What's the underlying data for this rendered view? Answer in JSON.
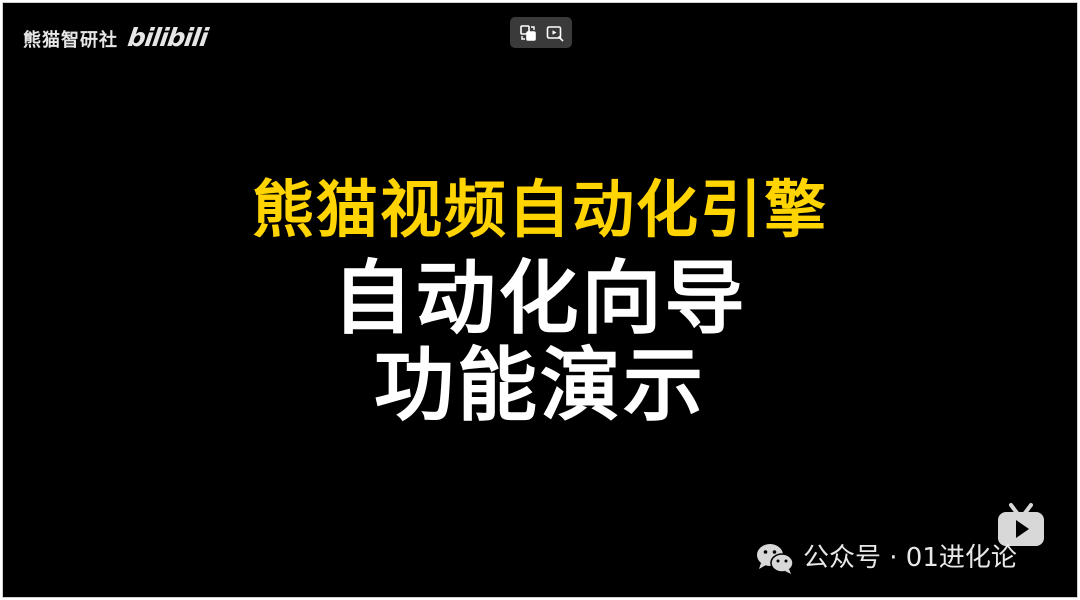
{
  "video": {
    "watermark_text": "熊猫智研社",
    "watermark_logo": "bilibili",
    "title_line1": "熊猫视频自动化引擎",
    "title_line2": "自动化向导",
    "title_line3": "功能演示",
    "title_line1_color": "#ffd400",
    "title_color": "#ffffff",
    "background_color": "#000000"
  },
  "controls": {
    "icons": [
      "switch-screen-icon",
      "play-window-icon"
    ]
  },
  "footer": {
    "account_text": "公众号 · 01进化论",
    "icons": [
      "wechat-icon",
      "tv-play-icon"
    ]
  }
}
